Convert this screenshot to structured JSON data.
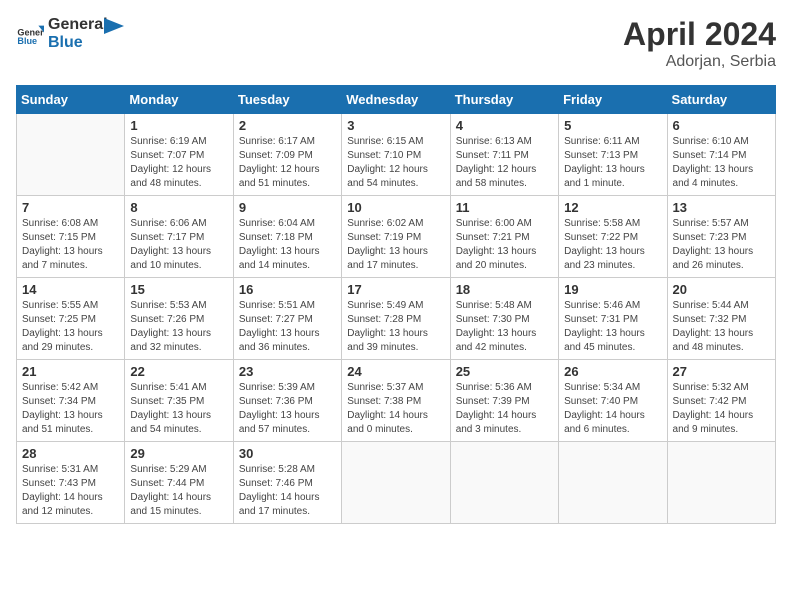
{
  "header": {
    "logo_general": "General",
    "logo_blue": "Blue",
    "month": "April 2024",
    "location": "Adorjan, Serbia"
  },
  "days_of_week": [
    "Sunday",
    "Monday",
    "Tuesday",
    "Wednesday",
    "Thursday",
    "Friday",
    "Saturday"
  ],
  "weeks": [
    [
      {
        "day": "",
        "info": ""
      },
      {
        "day": "1",
        "info": "Sunrise: 6:19 AM\nSunset: 7:07 PM\nDaylight: 12 hours\nand 48 minutes."
      },
      {
        "day": "2",
        "info": "Sunrise: 6:17 AM\nSunset: 7:09 PM\nDaylight: 12 hours\nand 51 minutes."
      },
      {
        "day": "3",
        "info": "Sunrise: 6:15 AM\nSunset: 7:10 PM\nDaylight: 12 hours\nand 54 minutes."
      },
      {
        "day": "4",
        "info": "Sunrise: 6:13 AM\nSunset: 7:11 PM\nDaylight: 12 hours\nand 58 minutes."
      },
      {
        "day": "5",
        "info": "Sunrise: 6:11 AM\nSunset: 7:13 PM\nDaylight: 13 hours\nand 1 minute."
      },
      {
        "day": "6",
        "info": "Sunrise: 6:10 AM\nSunset: 7:14 PM\nDaylight: 13 hours\nand 4 minutes."
      }
    ],
    [
      {
        "day": "7",
        "info": "Sunrise: 6:08 AM\nSunset: 7:15 PM\nDaylight: 13 hours\nand 7 minutes."
      },
      {
        "day": "8",
        "info": "Sunrise: 6:06 AM\nSunset: 7:17 PM\nDaylight: 13 hours\nand 10 minutes."
      },
      {
        "day": "9",
        "info": "Sunrise: 6:04 AM\nSunset: 7:18 PM\nDaylight: 13 hours\nand 14 minutes."
      },
      {
        "day": "10",
        "info": "Sunrise: 6:02 AM\nSunset: 7:19 PM\nDaylight: 13 hours\nand 17 minutes."
      },
      {
        "day": "11",
        "info": "Sunrise: 6:00 AM\nSunset: 7:21 PM\nDaylight: 13 hours\nand 20 minutes."
      },
      {
        "day": "12",
        "info": "Sunrise: 5:58 AM\nSunset: 7:22 PM\nDaylight: 13 hours\nand 23 minutes."
      },
      {
        "day": "13",
        "info": "Sunrise: 5:57 AM\nSunset: 7:23 PM\nDaylight: 13 hours\nand 26 minutes."
      }
    ],
    [
      {
        "day": "14",
        "info": "Sunrise: 5:55 AM\nSunset: 7:25 PM\nDaylight: 13 hours\nand 29 minutes."
      },
      {
        "day": "15",
        "info": "Sunrise: 5:53 AM\nSunset: 7:26 PM\nDaylight: 13 hours\nand 32 minutes."
      },
      {
        "day": "16",
        "info": "Sunrise: 5:51 AM\nSunset: 7:27 PM\nDaylight: 13 hours\nand 36 minutes."
      },
      {
        "day": "17",
        "info": "Sunrise: 5:49 AM\nSunset: 7:28 PM\nDaylight: 13 hours\nand 39 minutes."
      },
      {
        "day": "18",
        "info": "Sunrise: 5:48 AM\nSunset: 7:30 PM\nDaylight: 13 hours\nand 42 minutes."
      },
      {
        "day": "19",
        "info": "Sunrise: 5:46 AM\nSunset: 7:31 PM\nDaylight: 13 hours\nand 45 minutes."
      },
      {
        "day": "20",
        "info": "Sunrise: 5:44 AM\nSunset: 7:32 PM\nDaylight: 13 hours\nand 48 minutes."
      }
    ],
    [
      {
        "day": "21",
        "info": "Sunrise: 5:42 AM\nSunset: 7:34 PM\nDaylight: 13 hours\nand 51 minutes."
      },
      {
        "day": "22",
        "info": "Sunrise: 5:41 AM\nSunset: 7:35 PM\nDaylight: 13 hours\nand 54 minutes."
      },
      {
        "day": "23",
        "info": "Sunrise: 5:39 AM\nSunset: 7:36 PM\nDaylight: 13 hours\nand 57 minutes."
      },
      {
        "day": "24",
        "info": "Sunrise: 5:37 AM\nSunset: 7:38 PM\nDaylight: 14 hours\nand 0 minutes."
      },
      {
        "day": "25",
        "info": "Sunrise: 5:36 AM\nSunset: 7:39 PM\nDaylight: 14 hours\nand 3 minutes."
      },
      {
        "day": "26",
        "info": "Sunrise: 5:34 AM\nSunset: 7:40 PM\nDaylight: 14 hours\nand 6 minutes."
      },
      {
        "day": "27",
        "info": "Sunrise: 5:32 AM\nSunset: 7:42 PM\nDaylight: 14 hours\nand 9 minutes."
      }
    ],
    [
      {
        "day": "28",
        "info": "Sunrise: 5:31 AM\nSunset: 7:43 PM\nDaylight: 14 hours\nand 12 minutes."
      },
      {
        "day": "29",
        "info": "Sunrise: 5:29 AM\nSunset: 7:44 PM\nDaylight: 14 hours\nand 15 minutes."
      },
      {
        "day": "30",
        "info": "Sunrise: 5:28 AM\nSunset: 7:46 PM\nDaylight: 14 hours\nand 17 minutes."
      },
      {
        "day": "",
        "info": ""
      },
      {
        "day": "",
        "info": ""
      },
      {
        "day": "",
        "info": ""
      },
      {
        "day": "",
        "info": ""
      }
    ]
  ]
}
